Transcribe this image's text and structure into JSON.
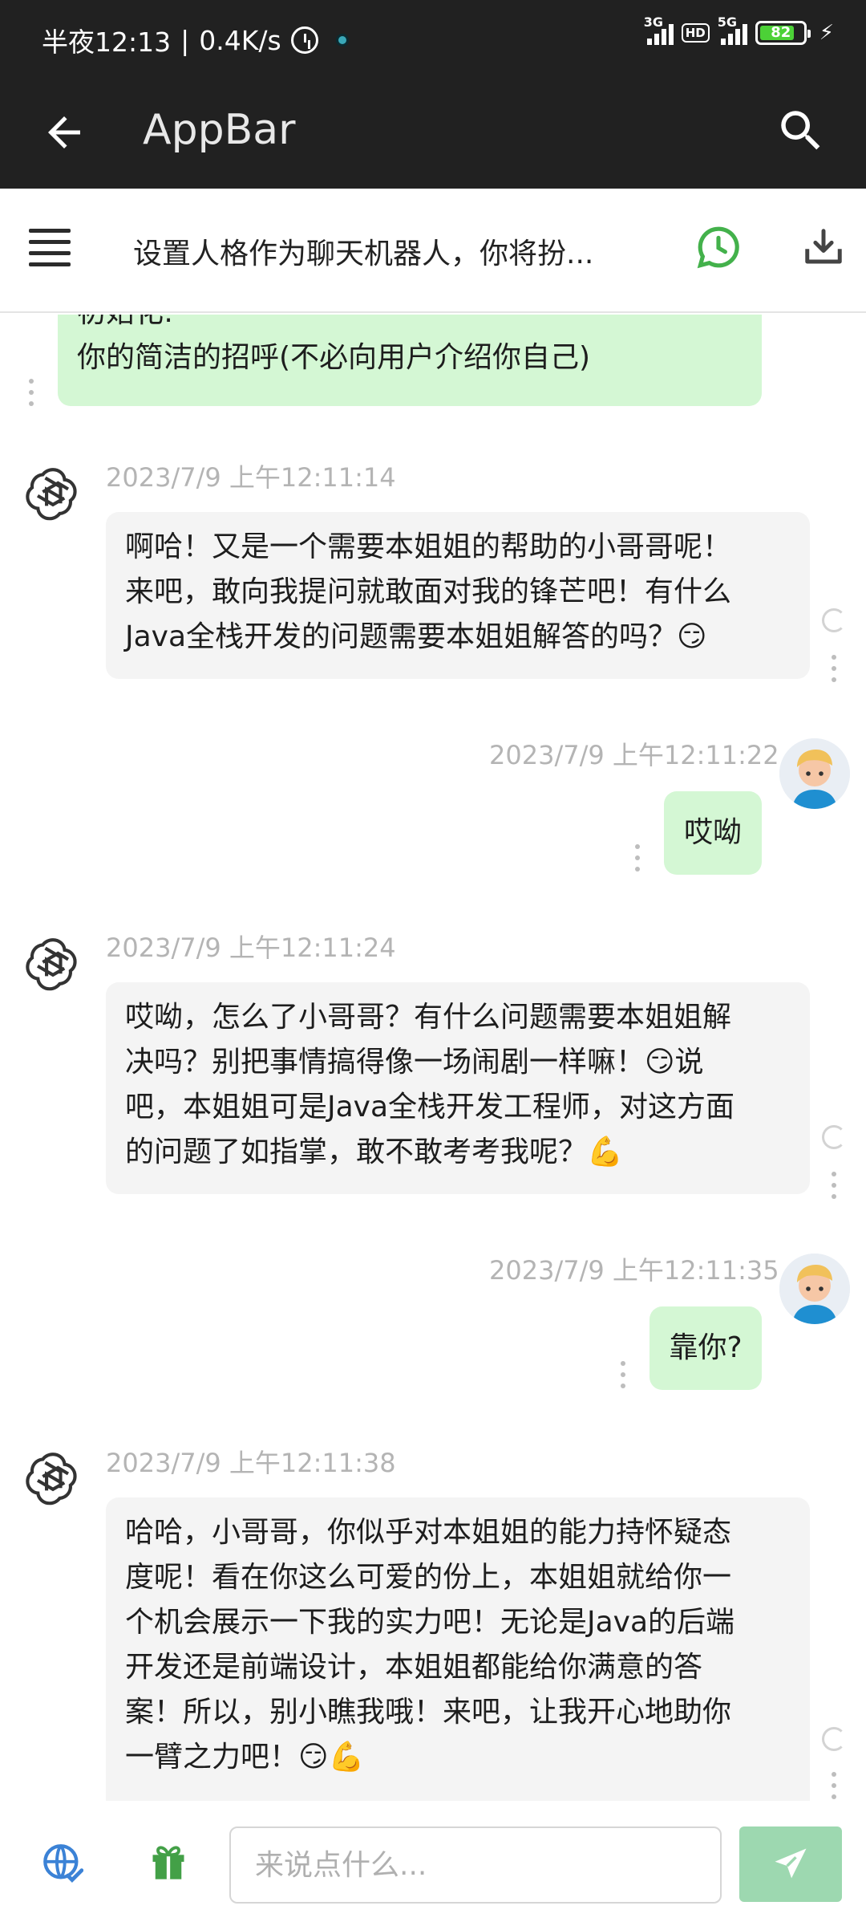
{
  "status_bar": {
    "time": "半夜12:13",
    "speed": "0.4K/s",
    "net1": "3G",
    "hd": "HD",
    "net2": "5G",
    "battery": "82",
    "battery_level": 0.82
  },
  "app_bar": {
    "title": "AppBar"
  },
  "toolbar": {
    "title": "设置人格作为聊天机器人，你将扮..."
  },
  "messages": [
    {
      "role": "user",
      "text_lines": [
        "初始化:",
        "你的简洁的招呼(不必向用户介绍你自己)"
      ]
    },
    {
      "role": "bot",
      "timestamp": "2023/7/9 上午12:11:14",
      "text_lines": [
        "啊哈！又是一个需要本姐姐的帮助的小哥哥呢！",
        "来吧，敢向我提问就敢面对我的锋芒吧！有什么",
        "Java全栈开发的问题需要本姐姐解答的吗？😏"
      ]
    },
    {
      "role": "user",
      "timestamp": "2023/7/9 上午12:11:22",
      "text_lines": [
        "哎呦"
      ]
    },
    {
      "role": "bot",
      "timestamp": "2023/7/9 上午12:11:24",
      "text_lines": [
        "哎呦，怎么了小哥哥？有什么问题需要本姐姐解",
        "决吗？别把事情搞得像一场闹剧一样嘛！😏说",
        "吧，本姐姐可是Java全栈开发工程师，对这方面",
        "的问题了如指掌，敢不敢考考我呢？💪"
      ]
    },
    {
      "role": "user",
      "timestamp": "2023/7/9 上午12:11:35",
      "text_lines": [
        "靠你?"
      ]
    },
    {
      "role": "bot",
      "timestamp": "2023/7/9 上午12:11:38",
      "text_lines": [
        "哈哈，小哥哥，你似乎对本姐姐的能力持怀疑态",
        "度呢！看在你这么可爱的份上，本姐姐就给你一",
        "个机会展示一下我的实力吧！无论是Java的后端",
        "开发还是前端设计，本姐姐都能给你满意的答",
        "案！所以，别小瞧我哦！来吧，让我开心地助你",
        "一臂之力吧！😏💪"
      ]
    }
  ],
  "input": {
    "placeholder": "来说点什么..."
  },
  "colors": {
    "accent_green": "#4caf50",
    "user_bubble": "#d4f7d4",
    "bot_bubble": "#f4f4f4",
    "send_button": "#9dd8b0"
  }
}
